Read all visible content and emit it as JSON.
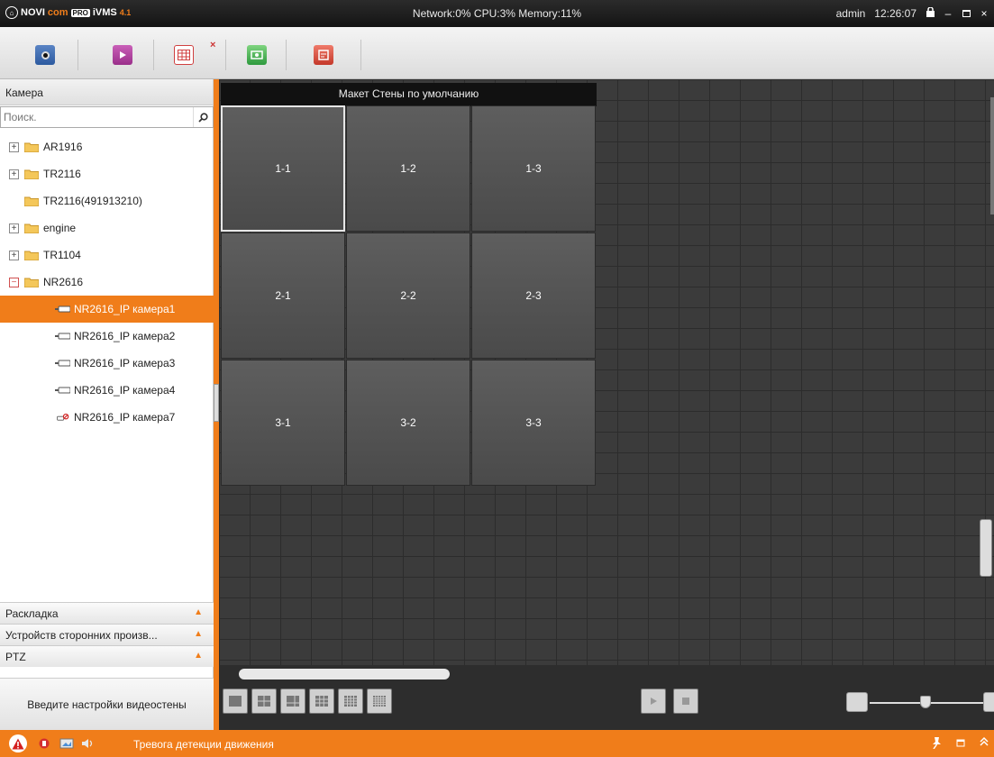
{
  "titlebar": {
    "logo": {
      "nov": "NOVI",
      "com": "com",
      "pro": "PRO",
      "ivms": "iVMS",
      "ver": "4.1"
    },
    "stats": "Network:0% CPU:3% Memory:11%",
    "user": "admin",
    "time": "12:26:07"
  },
  "sidebar": {
    "header": "Камера",
    "search_placeholder": "Поиск.",
    "tree": [
      {
        "label": "AR1916",
        "type": "folder",
        "expander": "+"
      },
      {
        "label": "TR2116",
        "type": "folder",
        "expander": "+"
      },
      {
        "label": "TR2116(491913210)",
        "type": "folder",
        "expander": ""
      },
      {
        "label": "engine",
        "type": "folder",
        "expander": "+"
      },
      {
        "label": "TR1104",
        "type": "folder",
        "expander": "+"
      },
      {
        "label": "NR2616",
        "type": "folder",
        "expander": "−"
      },
      {
        "label": "NR2616_IP камера1",
        "type": "camera",
        "selected": true
      },
      {
        "label": "NR2616_IP камера2",
        "type": "camera"
      },
      {
        "label": "NR2616_IP камера3",
        "type": "camera"
      },
      {
        "label": "NR2616_IP камера4",
        "type": "camera"
      },
      {
        "label": "NR2616_IP камера7",
        "type": "camera-offline"
      }
    ],
    "sections": [
      {
        "label": "Раскладка"
      },
      {
        "label": "Устройств сторонних произв..."
      },
      {
        "label": "PTZ"
      }
    ],
    "action_button": "Введите настройки видеостены"
  },
  "wall": {
    "title": "Макет Стены по умолчанию",
    "cells": [
      "1-1",
      "1-2",
      "1-3",
      "2-1",
      "2-2",
      "2-3",
      "3-1",
      "3-2",
      "3-3"
    ],
    "active_cell": "1-1"
  },
  "statusbar": {
    "alarm_text": "Тревога детекции движения"
  },
  "colors": {
    "accent": "#f07d1a",
    "titlebar": "#1c1c1c",
    "wall_bg": "#3b3b3b",
    "cell": "#555555"
  }
}
